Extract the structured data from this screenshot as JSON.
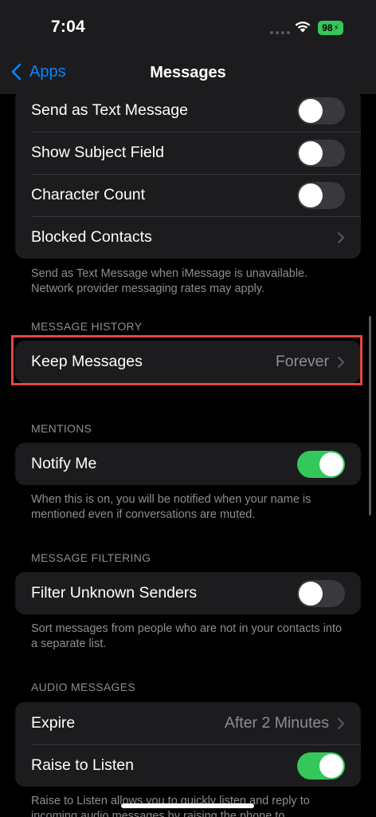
{
  "status_bar": {
    "time": "7:04",
    "battery_level": "98"
  },
  "nav": {
    "back_label": "Apps",
    "title": "Messages"
  },
  "sms_group": {
    "rows": [
      {
        "label": "Send as Text Message",
        "toggle": false
      },
      {
        "label": "Show Subject Field",
        "toggle": false
      },
      {
        "label": "Character Count",
        "toggle": false
      },
      {
        "label": "Blocked Contacts"
      }
    ],
    "footnote": "Send as Text Message when iMessage is unavailable. Network provider messaging rates may apply."
  },
  "message_history": {
    "header": "MESSAGE HISTORY",
    "row": {
      "label": "Keep Messages",
      "value": "Forever"
    }
  },
  "mentions": {
    "header": "MENTIONS",
    "row": {
      "label": "Notify Me",
      "toggle": true
    },
    "footnote": "When this is on, you will be notified when your name is mentioned even if conversations are muted."
  },
  "message_filtering": {
    "header": "MESSAGE FILTERING",
    "row": {
      "label": "Filter Unknown Senders",
      "toggle": false
    },
    "footnote": "Sort messages from people who are not in your contacts into a separate list."
  },
  "audio_messages": {
    "header": "AUDIO MESSAGES",
    "rows": [
      {
        "label": "Expire",
        "value": "After 2 Minutes"
      },
      {
        "label": "Raise to Listen",
        "toggle": true
      }
    ],
    "footnote": "Raise to Listen allows you to quickly listen and reply to incoming audio messages by raising the phone to"
  },
  "colors": {
    "accent": "#0a84ff",
    "toggle_on": "#34c759",
    "highlight": "#e5483c"
  }
}
